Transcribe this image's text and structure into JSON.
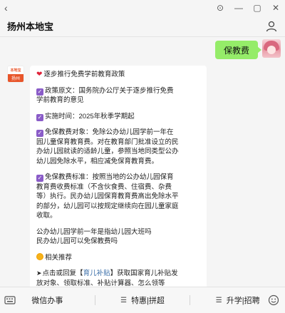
{
  "window": {
    "back_glyph": "‹",
    "controls": {
      "pin": "⊙",
      "minimize": "—",
      "maximize": "▢",
      "close": "✕"
    }
  },
  "header": {
    "title": "扬州本地宝"
  },
  "chat": {
    "user_message": "保教费",
    "bot_avatar": {
      "top_text": "本地宝",
      "bottom_text": "扬州"
    },
    "bot_message": {
      "title": "逐步推行免费学前教育政策",
      "policy_source_lines": [
        "政策原文：国务院办公厅关于逐步推行免费",
        "学前教育的意见"
      ],
      "implementation_time": "实施时间：2025年秋季学期起",
      "exemption_target_lines": [
        "免保教费对象：免除公办幼儿园学前一年在",
        "园儿童保育教育费。对在教育部门批准设立的民",
        "办幼儿园就读的适龄儿童，参照当地同类型公办",
        "幼儿园免除水平，相应减免保育教育费。"
      ],
      "exemption_standard_lines": [
        "免保教费标准：按照当地的公办幼儿园保育",
        "教育费收费标准（不含伙食费、住宿费、杂费",
        "等）执行。民办幼儿园保育教育费高出免除水平",
        "的部分，幼儿园可以按规定继续向在园儿童家庭",
        "收取。"
      ],
      "note_lines": [
        "公办幼儿园学前一年是指幼儿园大班吗",
        "民办幼儿园可以免保教费吗"
      ],
      "related": "相关推荐",
      "promo_prefix": "点击或回复【",
      "promo_link": "育儿补贴",
      "promo_suffix": "】获取国家育儿补贴发",
      "promo_line2": "放对象、领取标准、补贴计算器、怎么领等"
    }
  },
  "bottom_bar": {
    "items": [
      "微信办事",
      "特惠|拼超",
      "升学|招聘"
    ]
  },
  "colors": {
    "user_bubble": "#95ec69",
    "brand": "#e8552a",
    "check": "#8a5cc8"
  }
}
